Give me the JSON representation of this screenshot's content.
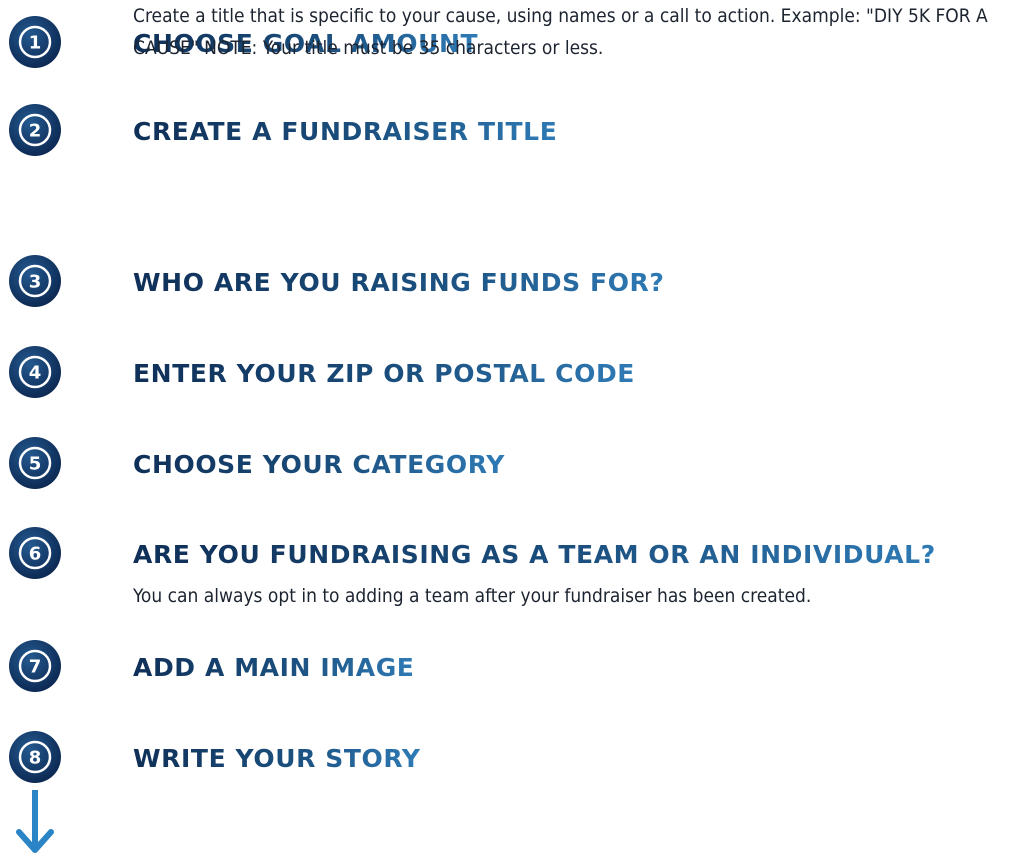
{
  "colors": {
    "circle_dark": "#0d2b55",
    "circle_mid": "#1d4f86",
    "line_top": "#10345f",
    "line_bottom": "#2a84c6",
    "title_dark": "#0f2f57",
    "title_light": "#2f7bb6",
    "desc_text": "#1c2430"
  },
  "steps": [
    {
      "number": "1",
      "title": "CHOOSE GOAL AMOUNT",
      "description": ""
    },
    {
      "number": "2",
      "title": "CREATE A FUNDRAISER TITLE",
      "description": "Create a title that is specific to your cause, using names or a call to action. Example: \"DIY 5K FOR A CAUSE\"  NOTE: Your title must be 35 characters or less."
    },
    {
      "number": "3",
      "title": "WHO ARE YOU RAISING FUNDS FOR?",
      "description": ""
    },
    {
      "number": "4",
      "title": "ENTER YOUR ZIP OR POSTAL CODE",
      "description": ""
    },
    {
      "number": "5",
      "title": "CHOOSE YOUR CATEGORY",
      "description": ""
    },
    {
      "number": "6",
      "title": "ARE YOU FUNDRAISING AS A TEAM OR AN INDIVIDUAL?",
      "description": "You can always opt in to adding a team after your fundraiser has been created."
    },
    {
      "number": "7",
      "title": "ADD A MAIN IMAGE",
      "description": ""
    },
    {
      "number": "8",
      "title": "WRITE YOUR STORY",
      "description": ""
    }
  ],
  "end_marker_icon": "arrow-down-icon"
}
